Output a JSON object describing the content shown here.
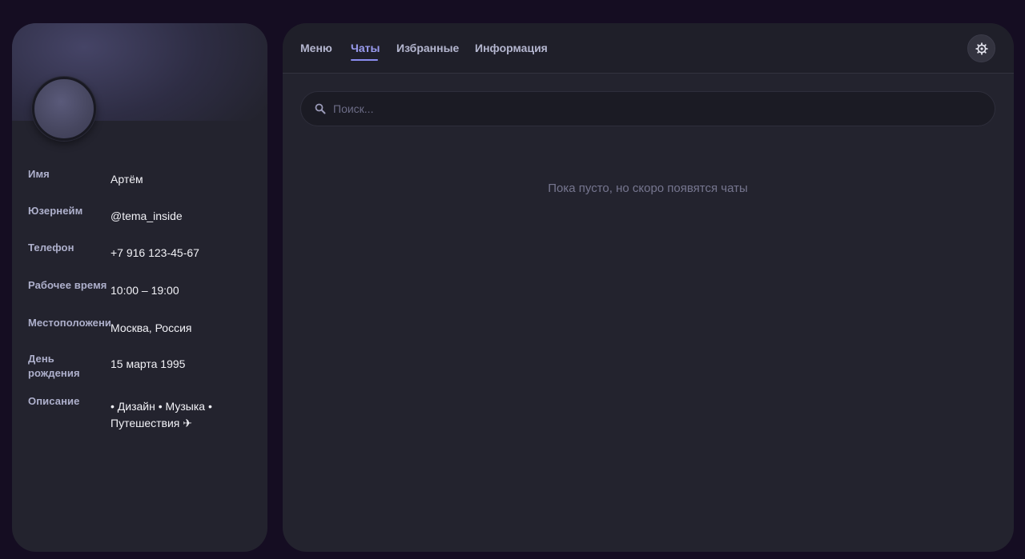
{
  "profile": {
    "rows": [
      {
        "label": "Имя",
        "value": "Артём"
      },
      {
        "label": "Юзернейм",
        "value": "@tema_inside"
      },
      {
        "label": "Телефон",
        "value": "+7 916 123-45-67"
      },
      {
        "label": "Рабочее время",
        "value": "10:00 – 19:00"
      },
      {
        "label": "Местоположение",
        "value": "Москва, Россия"
      },
      {
        "label": "День рождения",
        "value": "15 марта 1995"
      },
      {
        "label": "Описание",
        "value": "• Дизайн • Музыка • Путешествия ✈"
      }
    ]
  },
  "nav": {
    "tabs": [
      {
        "label": "Меню"
      },
      {
        "label": "Чаты"
      },
      {
        "label": "Избранные"
      },
      {
        "label": "Информация"
      }
    ],
    "active_tab": "Чаты",
    "settings_icon": "gear-icon"
  },
  "search": {
    "placeholder": "Поиск...",
    "value": "",
    "icon": "search-icon"
  },
  "chats": {
    "empty_message": "Пока пусто, но скоро появятся чаты"
  },
  "colors": {
    "background": "#150d22",
    "panel": "#23232e",
    "accent": "#8b8df0"
  }
}
